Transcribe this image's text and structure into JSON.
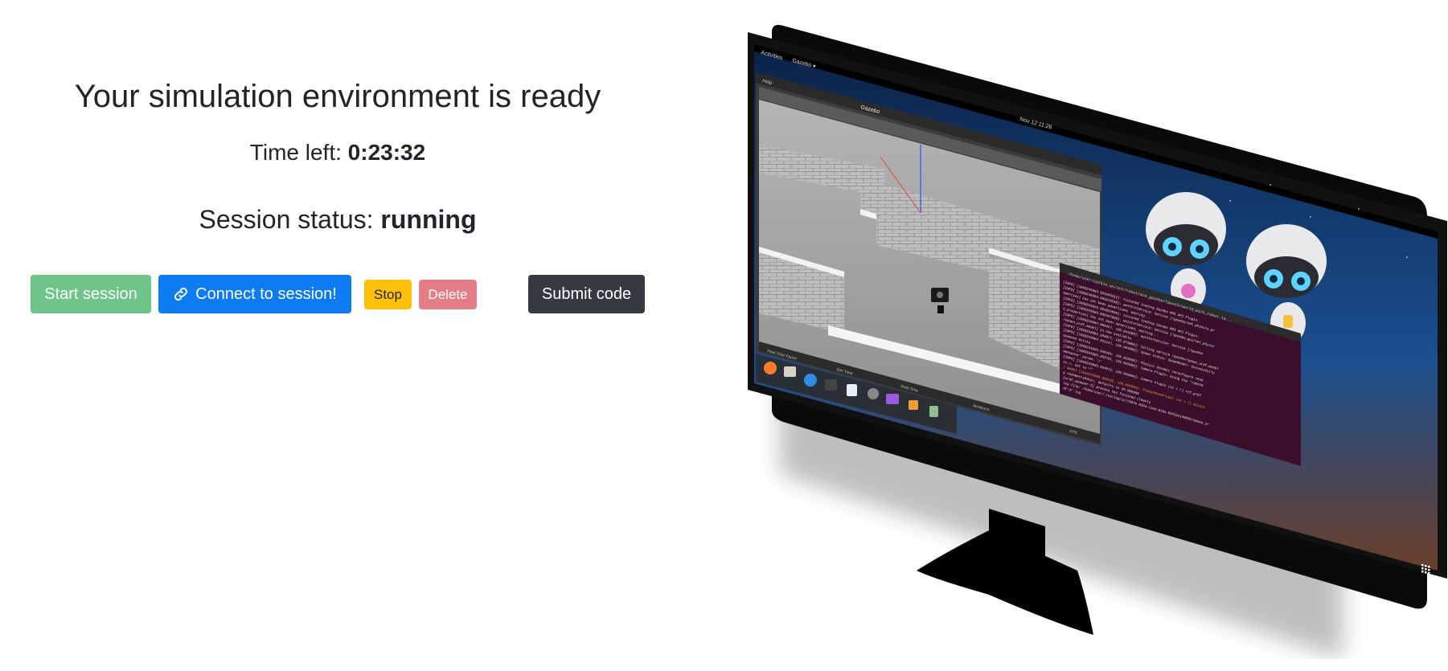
{
  "header": {
    "title": "Your simulation environment is ready",
    "time_left_label": "Time left:",
    "time_left_value": "0:23:32",
    "status_label": "Session status:",
    "status_value": "running"
  },
  "actions": {
    "start": "Start session",
    "connect": "Connect to session!",
    "stop": "Stop",
    "delete": "Delete",
    "submit": "Submit code"
  },
  "preview": {
    "activities": "Activities",
    "app_menu": "Gazebo ▾",
    "clock": "Nov 12 11:26",
    "gazebo_title": "Gazebo",
    "help_menu": "Help",
    "real_time_factor": "Real Time Factor",
    "sim_time": "Sim Time",
    "real_time": "Real Time",
    "iterations": "Iterations",
    "fps": "FPS",
    "terminal_path": "/home/user/catkin_ws/src/robotrace_gazebo/launch/world_with_robot.la...",
    "terminal_lines": [
      "[INFO] [1668245683.503205312]: Finished loading Gazebo ROS API Plugin.",
      "[INFO] [1668245683.503978530]: waitForService: Service [/gazebo/set_physics_pr",
      "operties] has not been advertised, waiting...",
      "[INFO] [1668245683.604824096]: Finished loading Gazebo ROS API Plugin.",
      "[INFO] [1668245683.605347908]: waitForService: Service [/gazebo_gui/set_physic",
      "s_properties] has not been advertised, waiting...",
      "[INFO] [1668245684.084427, 135.841000]: waitForService: Service [/gazebo",
      "/spawn_urdf_model] is now available.",
      "[INFO] [1668245684.106077, 135.873000]: Calling service /gazebo/spawn_urdf_model",
      "[INFO] [1668245684.311147, 135.964000]: Spawn status: SpawnModel: Successfully",
      "spawned entity",
      "[INFO] [1668245685.646439, 136.023000]: Physics dynamic reconfigure read",
      "[INFO] [1668245685.653721, 136.025000]: Camera Plugin: Using the 'robotN",
      "amespace' param: '/'",
      "[INFO] [1668245685.654672, 136.028000]: Camera Plugin (ns = /)  <tf_pref",
      "ix_>, set to \"\"",
      "[ WARN] [1668245685.660932, 136.034000]: PlanarMovePlugin (ns = /) missin",
      "g <odometryRate>, defaults to 20.000000",
      "[urdf_spawner-3] process has finished cleanly",
      "log file: /home/user/.ros/log/1c7766fe-626d-11ed-818a-0242ac140002/spawn_ur",
      "df-3*.log"
    ]
  },
  "colors": {
    "start": "#6fc48a",
    "connect": "#0d7cf2",
    "stop": "#ffc107",
    "delete": "#e57d86",
    "submit": "#343a40",
    "terminal_bg": "#3b0f2b"
  }
}
